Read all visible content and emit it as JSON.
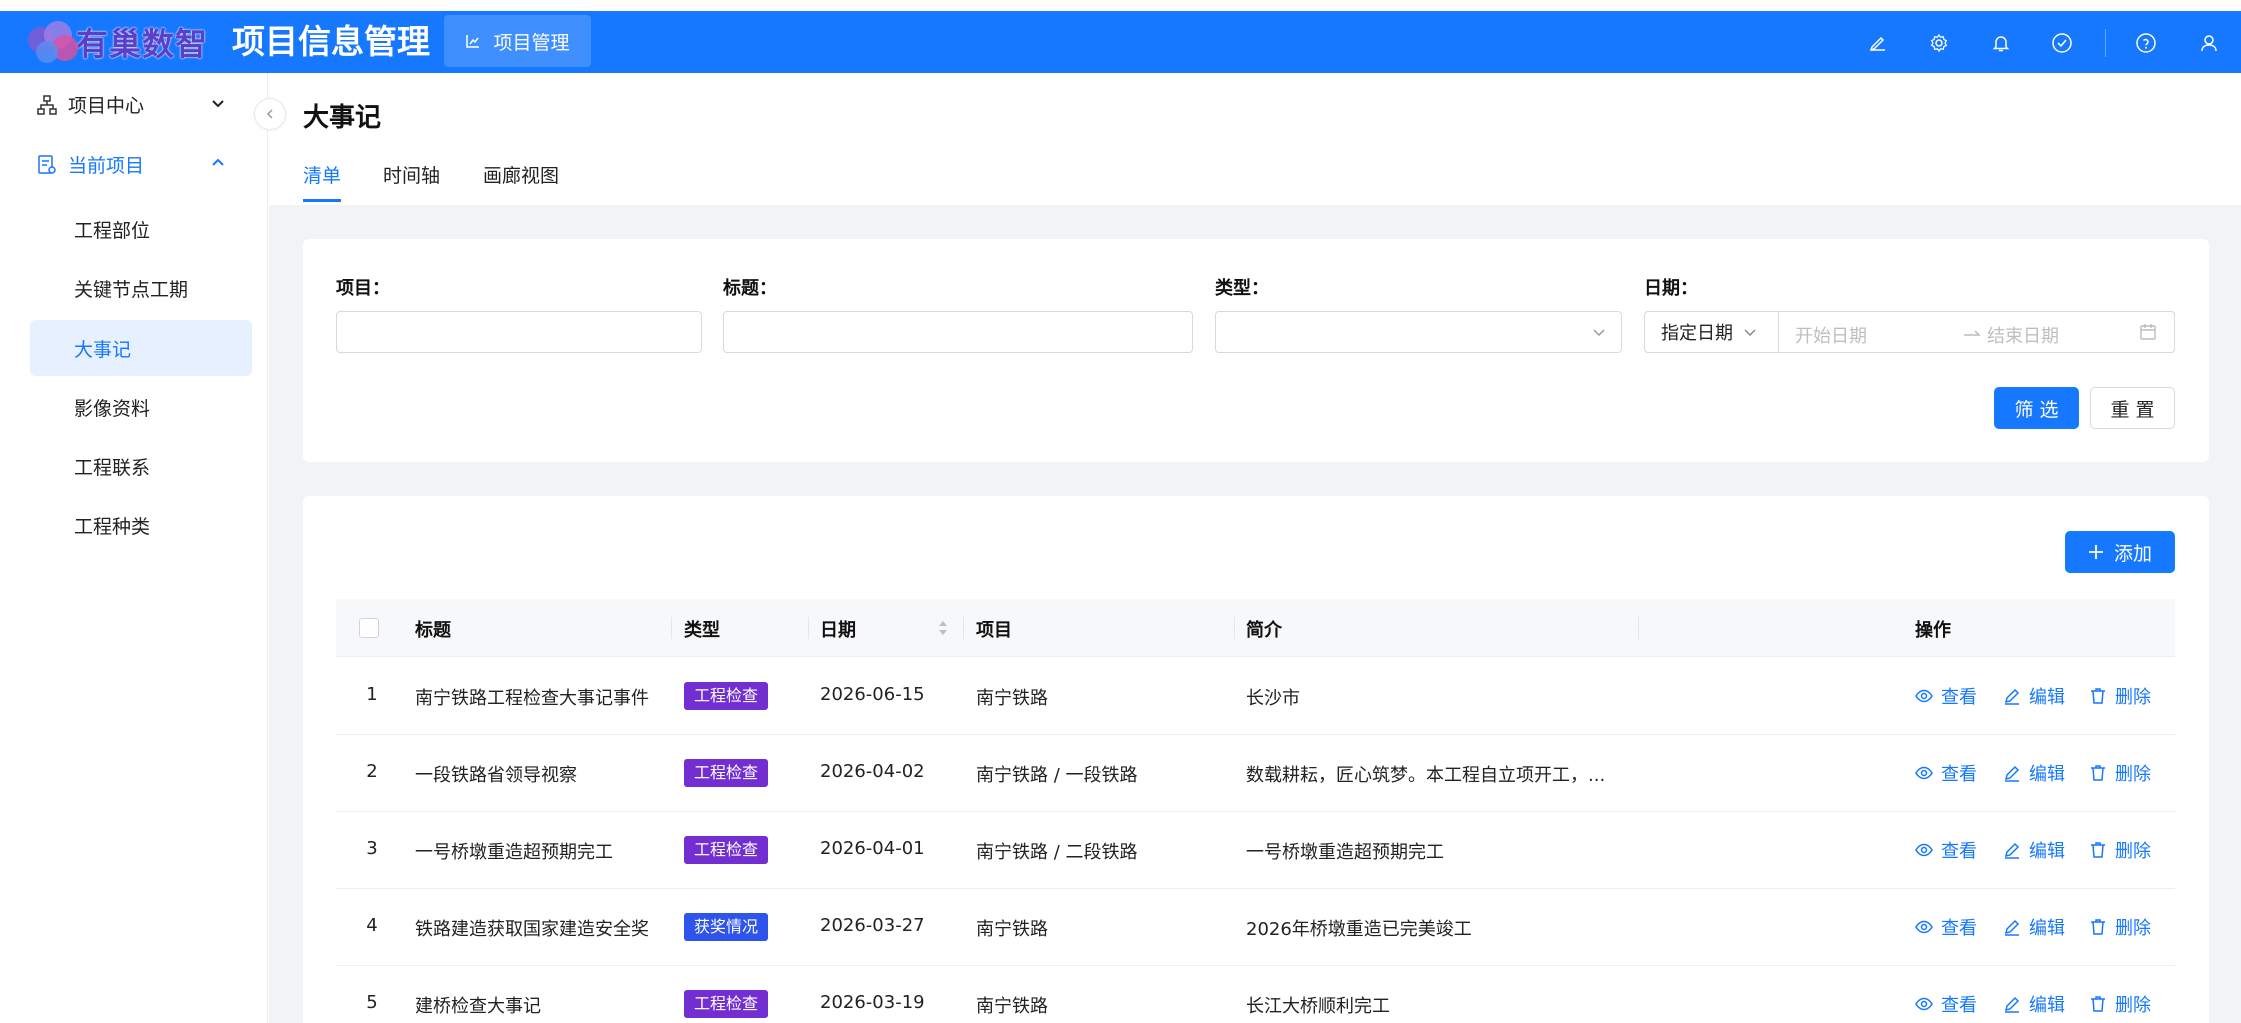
{
  "header": {
    "logo_text": "有巢数智",
    "app_title": "项目信息管理",
    "module_tab": "项目管理",
    "icons": [
      "brush-icon",
      "gear-icon",
      "bell-icon",
      "check-circle-icon",
      "help-icon",
      "user-icon"
    ]
  },
  "sidebar": {
    "groups": [
      {
        "label": "项目中心",
        "icon": "sitemap-icon",
        "expanded": false
      },
      {
        "label": "当前项目",
        "icon": "project-icon",
        "expanded": true
      }
    ],
    "items": [
      {
        "label": "工程部位"
      },
      {
        "label": "关键节点工期"
      },
      {
        "label": "大事记",
        "active": true
      },
      {
        "label": "影像资料"
      },
      {
        "label": "工程联系"
      },
      {
        "label": "工程种类"
      }
    ]
  },
  "page": {
    "title": "大事记",
    "tabs": [
      "清单",
      "时间轴",
      "画廊视图"
    ],
    "active_tab": "清单"
  },
  "filter": {
    "project_label": "项目：",
    "title_label": "标题：",
    "type_label": "类型：",
    "date_label": "日期：",
    "date_mode": "指定日期",
    "start_placeholder": "开始日期",
    "end_placeholder": "结束日期",
    "filter_button": "筛 选",
    "reset_button": "重 置"
  },
  "table": {
    "add_button": "添加",
    "columns": [
      "标题",
      "类型",
      "日期",
      "项目",
      "简介",
      "操作"
    ],
    "actions": [
      "查看",
      "编辑",
      "删除"
    ],
    "rows": [
      {
        "no": "1",
        "title": "南宁铁路工程检查大事记事件",
        "type": "工程检查",
        "type_color": "#722ed1",
        "date": "2026-06-15",
        "project": "南宁铁路",
        "summary": "长沙市"
      },
      {
        "no": "2",
        "title": "一段铁路省领导视察",
        "type": "工程检查",
        "type_color": "#722ed1",
        "date": "2026-04-02",
        "project": "南宁铁路 / 一段铁路",
        "summary": "数载耕耘，匠心筑梦。本工程自立项开工，..."
      },
      {
        "no": "3",
        "title": "一号桥墩重造超预期完工",
        "type": "工程检查",
        "type_color": "#722ed1",
        "date": "2026-04-01",
        "project": "南宁铁路 / 二段铁路",
        "summary": "一号桥墩重造超预期完工"
      },
      {
        "no": "4",
        "title": "铁路建造获取国家建造安全奖",
        "type": "获奖情况",
        "type_color": "#2f54eb",
        "date": "2026-03-27",
        "project": "南宁铁路",
        "summary": "2026年桥墩重造已完美竣工"
      },
      {
        "no": "5",
        "title": "建桥检查大事记",
        "type": "工程检查",
        "type_color": "#722ed1",
        "date": "2026-03-19",
        "project": "南宁铁路",
        "summary": "长江大桥顺利完工"
      }
    ]
  }
}
